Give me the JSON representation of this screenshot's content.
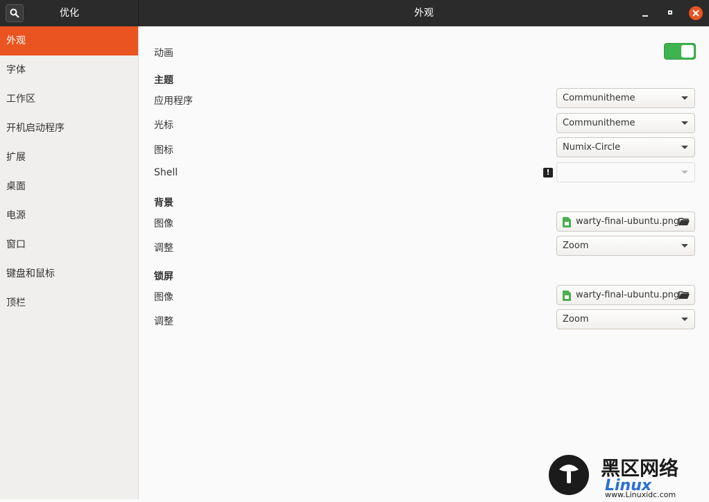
{
  "header": {
    "app_title": "优化",
    "window_title": "外观"
  },
  "sidebar": {
    "items": [
      {
        "label": "外观",
        "active": true
      },
      {
        "label": "字体"
      },
      {
        "label": "工作区"
      },
      {
        "label": "开机启动程序"
      },
      {
        "label": "扩展"
      },
      {
        "label": "桌面"
      },
      {
        "label": "电源"
      },
      {
        "label": "窗口"
      },
      {
        "label": "键盘和鼠标"
      },
      {
        "label": "顶栏"
      }
    ]
  },
  "main": {
    "animation_label": "动画",
    "animation_enabled": true,
    "themes_heading": "主题",
    "applications_label": "应用程序",
    "applications_value": "Communitheme",
    "cursor_label": "光标",
    "cursor_value": "Communitheme",
    "icons_label": "图标",
    "icons_value": "Numix-Circle",
    "shell_label": "Shell",
    "shell_value": "",
    "background_heading": "背景",
    "background_image_label": "图像",
    "background_image_value": "warty-final-ubuntu.png",
    "background_adjust_label": "调整",
    "background_adjust_value": "Zoom",
    "lockscreen_heading": "锁屏",
    "lockscreen_image_label": "图像",
    "lockscreen_image_value": "warty-final-ubuntu.png",
    "lockscreen_adjust_label": "调整",
    "lockscreen_adjust_value": "Zoom"
  },
  "watermark": {
    "text_cn": "黑区网络",
    "text_en": "Linux",
    "url": "www.Linuxidc.com"
  },
  "colors": {
    "accent": "#e95420",
    "toggle_on": "#3eb34f",
    "titlebar": "#2b2b2b"
  }
}
